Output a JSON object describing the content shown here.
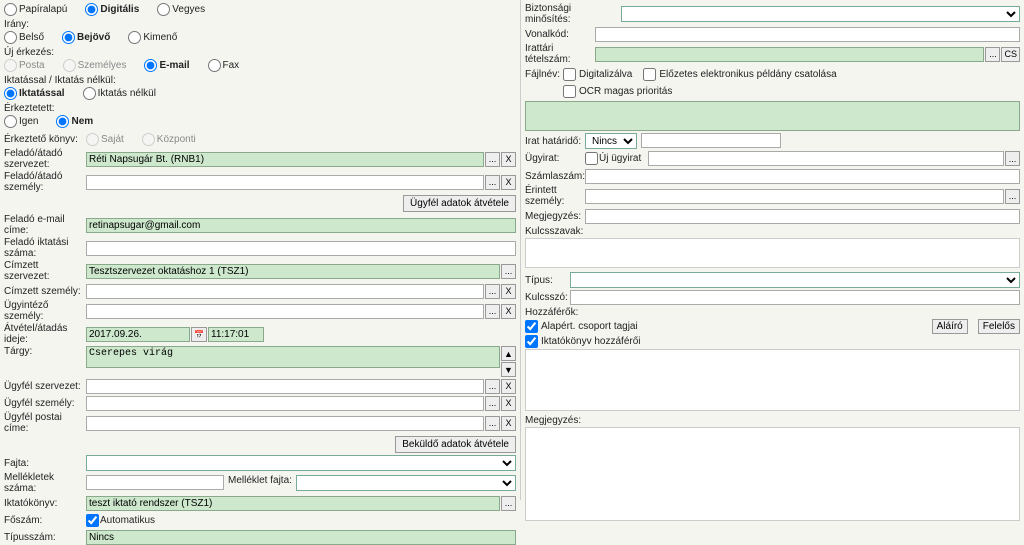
{
  "left": {
    "medium": {
      "paper": "Papíralapú",
      "digital": "Digitális",
      "mixed": "Vegyes"
    },
    "direction": {
      "label": "Irány:",
      "internal": "Belső",
      "incoming": "Bejövő",
      "outgoing": "Kimenő"
    },
    "arrival": {
      "label": "Új érkezés:",
      "post": "Posta",
      "personal": "Személyes",
      "email": "E-mail",
      "fax": "Fax"
    },
    "registering": {
      "label": "Iktatással / Iktatás nélkül:",
      "with": "Iktatással",
      "without": "Iktatás nélkül"
    },
    "received": {
      "label": "Érkeztetett:",
      "yes": "Igen",
      "no": "Nem"
    },
    "logbook": {
      "label": "Érkeztető könyv:",
      "own": "Saját",
      "central": "Központi"
    },
    "sender_org_label": "Feladó/átadó szervezet:",
    "sender_org_value": "Réti Napsugár Bt. (RNB1)",
    "sender_person_label": "Feladó/átadó személy:",
    "take_client_data": "Ügyfél adatok átvétele",
    "sender_email_label": "Feladó e-mail címe:",
    "sender_email_value": "retinapsugar@gmail.com",
    "sender_reg_label": "Feladó iktatási száma:",
    "addressee_org_label": "Címzett szervezet:",
    "addressee_org_value": "Tesztszervezet oktatáshoz 1 (TSZ1)",
    "addressee_person_label": "Címzett személy:",
    "clerk_label": "Ügyintéző személy:",
    "handover_time_label": "Átvétel/átadás ideje:",
    "handover_date": "2017.09.26.",
    "handover_time": "11:17:01",
    "subject_label": "Tárgy:",
    "subject_value": "Cserepes virág",
    "client_org_label": "Ügyfél szervezet:",
    "client_person_label": "Ügyfél személy:",
    "client_addr_label": "Ügyfél postai címe:",
    "take_submitter_data": "Beküldő adatok átvétele",
    "kind_label": "Fajta:",
    "attach_count_label": "Mellékletek száma:",
    "attach_kind_label": "Melléklet fajta:",
    "regbook_label": "Iktatókönyv:",
    "regbook_value": "teszt iktató rendszer (TSZ1)",
    "mainnum_label": "Főszám:",
    "auto_label": "Automatikus",
    "typenum_label": "Típusszám:",
    "typenum_value": "Nincs"
  },
  "right": {
    "sec_class_label": "Biztonsági minősítés:",
    "barcode_label": "Vonalkód:",
    "dossier_label": "Irattári tételszám:",
    "cs": "CS",
    "filename_label": "Fájlnév:",
    "digitized": "Digitalizálva",
    "pre_attach": "Előzetes elektronikus példány csatolása",
    "ocr": "OCR magas prioritás",
    "deadline_label": "Irat határidő:",
    "deadline_value": "Nincs",
    "case_label": "Ügyirat:",
    "new_case": "Új ügyirat",
    "invoice_label": "Számlaszám:",
    "affected_label": "Érintett személy:",
    "note_label": "Megjegyzés:",
    "keywords_label": "Kulcsszavak:",
    "type_label": "Típus:",
    "keyword_label": "Kulcsszó:",
    "access_label": "Hozzáférők:",
    "default_group": "Alapért. csoport tagjai",
    "regbook_access": "Iktatókönyv hozzáférői",
    "signer": "Aláíró",
    "responsible": "Felelős",
    "note2_label": "Megjegyzés:"
  },
  "ui": {
    "ellipsis": "...",
    "x": "X",
    "cal": "📅",
    "up": "▲",
    "down": "▼"
  }
}
